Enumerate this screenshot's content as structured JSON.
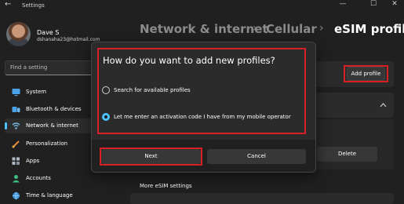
{
  "window": {
    "back_glyph": "←",
    "title": "Settings",
    "minimize_glyph": "—",
    "maximize_glyph": "☐",
    "close_glyph": "✕"
  },
  "user": {
    "name": "Dave S",
    "email": "dshanaha23@hotmail.com"
  },
  "search": {
    "placeholder": "Find a setting"
  },
  "sidebar": {
    "items": [
      {
        "label": "System",
        "icon": "monitor-icon",
        "selected": false
      },
      {
        "label": "Bluetooth & devices",
        "icon": "bluetooth-icon",
        "selected": false
      },
      {
        "label": "Network & internet",
        "icon": "wifi-icon",
        "selected": true
      },
      {
        "label": "Personalization",
        "icon": "brush-icon",
        "selected": false
      },
      {
        "label": "Apps",
        "icon": "apps-icon",
        "selected": false
      },
      {
        "label": "Accounts",
        "icon": "person-icon",
        "selected": false
      },
      {
        "label": "Time & language",
        "icon": "globe-icon",
        "selected": false
      }
    ]
  },
  "breadcrumb": {
    "items": [
      "Network & internet",
      "Cellular",
      "eSIM profiles"
    ],
    "separator": "›"
  },
  "main": {
    "add_profile_label": "Add profile",
    "delete_label": "Delete",
    "more_esim_label": "More eSIM settings"
  },
  "dialog": {
    "title": "How do you want to add new profiles?",
    "options": [
      {
        "label": "Search for available profiles",
        "checked": false
      },
      {
        "label": "Let me enter an activation code I have from my mobile operator",
        "checked": true
      }
    ],
    "next_label": "Next",
    "cancel_label": "Cancel"
  },
  "colors": {
    "accent": "#4cc2ff",
    "highlight_box": "#d81f26",
    "background": "#202020"
  }
}
